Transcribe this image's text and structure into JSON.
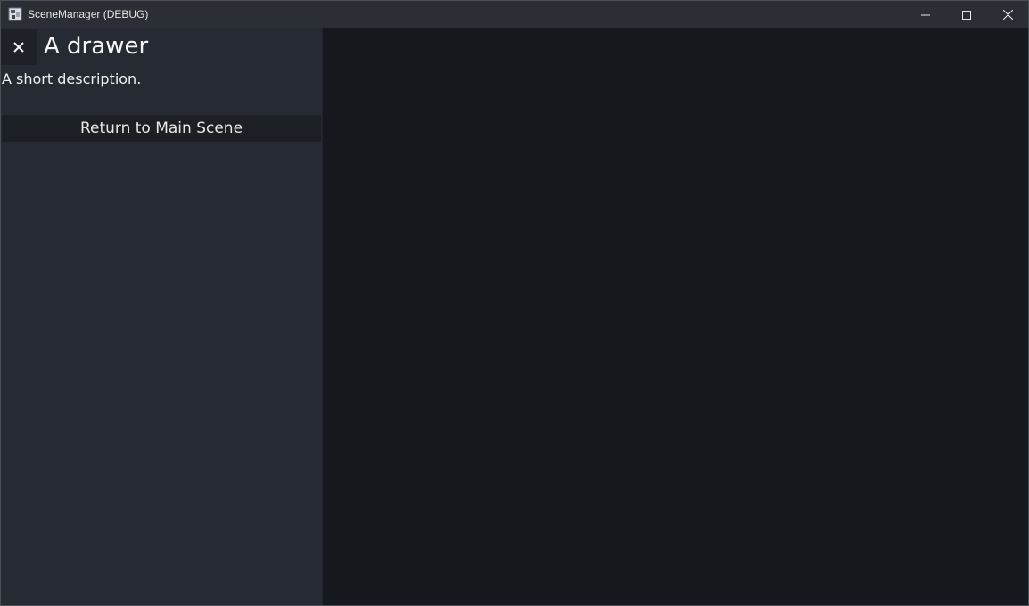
{
  "window": {
    "title": "SceneManager (DEBUG)",
    "icon": "app-icon",
    "controls": [
      "minimize-icon",
      "maximize-icon",
      "close-icon"
    ]
  },
  "drawer": {
    "close_icon": "close-icon",
    "title": "A drawer",
    "description": "A short description.",
    "return_button_label": "Return to Main Scene"
  },
  "colors": {
    "titlebar": "#2b2f35",
    "drawer_bg": "#252a33",
    "main_bg": "#15181d",
    "button_bg": "#1c1f24"
  }
}
